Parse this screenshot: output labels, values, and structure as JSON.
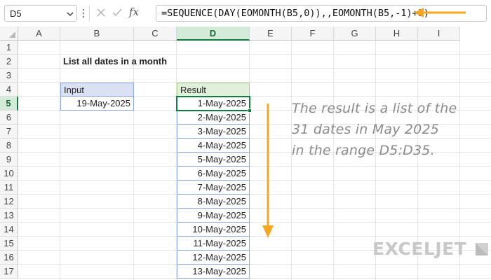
{
  "name_box": {
    "value": "D5"
  },
  "formula_bar": {
    "fx_label": "fx",
    "formula": "=SEQUENCE(DAY(EOMONTH(B5,0)),,EOMONTH(B5,-1)+1)",
    "accent_color": "#f5a623"
  },
  "grid": {
    "columns": [
      "A",
      "B",
      "C",
      "D",
      "E",
      "F",
      "G",
      "H",
      "I"
    ],
    "active_column": "D",
    "rows": [
      "1",
      "2",
      "3",
      "4",
      "5",
      "6",
      "7",
      "8",
      "9",
      "10",
      "11",
      "12",
      "13",
      "14",
      "15",
      "16",
      "17"
    ],
    "active_row": "5"
  },
  "sheet": {
    "title": "List all dates in a month",
    "input": {
      "header": "Input",
      "value": "19-May-2025"
    },
    "result": {
      "header": "Result",
      "values": [
        "1-May-2025",
        "2-May-2025",
        "3-May-2025",
        "4-May-2025",
        "5-May-2025",
        "6-May-2025",
        "7-May-2025",
        "8-May-2025",
        "9-May-2025",
        "10-May-2025",
        "11-May-2025",
        "12-May-2025",
        "13-May-2025"
      ]
    }
  },
  "note": {
    "lines": [
      "The result is a list of the",
      "31 dates in May 2025",
      "in the range D5:D35."
    ]
  },
  "logo": {
    "text": "EXCELJET"
  },
  "colors": {
    "arrow": "#f5a623",
    "selection": "#107c41",
    "input_header_fill": "#d9e1f2",
    "result_header_fill": "#e2efda"
  }
}
